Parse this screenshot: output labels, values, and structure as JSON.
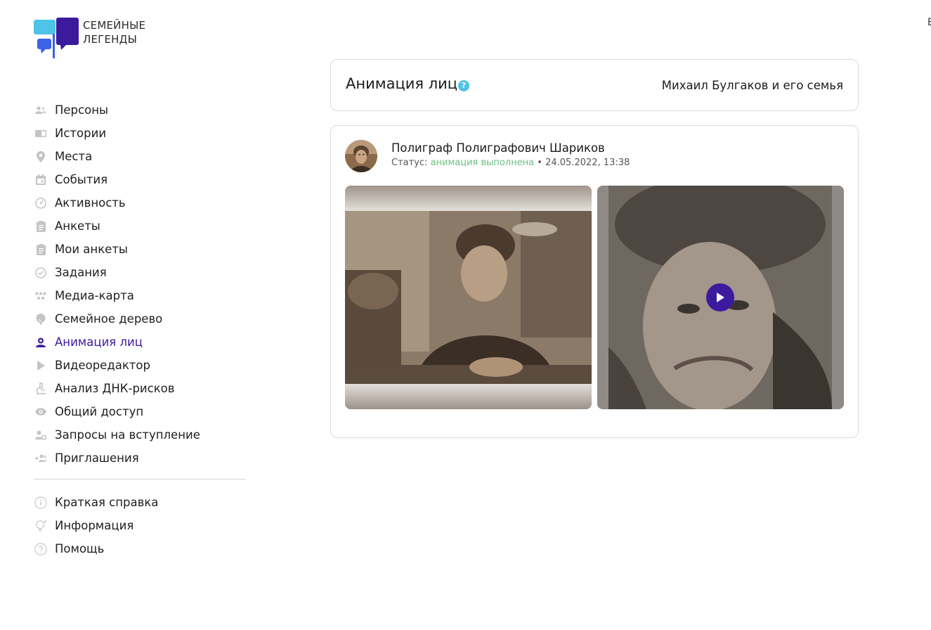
{
  "brand": {
    "line1": "СЕМЕЙНЫЕ",
    "line2": "ЛЕГЕНДЫ",
    "colors": {
      "light_blue": "#4fc3e8",
      "purple": "#3c1a9c",
      "blue": "#3c62e6"
    }
  },
  "corner_mark": "Е",
  "sidebar": {
    "items": [
      {
        "label": "Персоны",
        "icon": "persons-icon"
      },
      {
        "label": "Истории",
        "icon": "book-icon"
      },
      {
        "label": "Места",
        "icon": "location-pin-icon"
      },
      {
        "label": "События",
        "icon": "calendar-icon"
      },
      {
        "label": "Активность",
        "icon": "speedometer-icon"
      },
      {
        "label": "Анкеты",
        "icon": "clipboard-icon"
      },
      {
        "label": "Мои анкеты",
        "icon": "clipboard-icon"
      },
      {
        "label": "Задания",
        "icon": "check-circle-icon"
      },
      {
        "label": "Медиа-карта",
        "icon": "media-map-icon"
      },
      {
        "label": "Семейное дерево",
        "icon": "tree-icon"
      },
      {
        "label": "Анимация лиц",
        "icon": "face-icon",
        "active": true
      },
      {
        "label": "Видеоредактор",
        "icon": "play-icon"
      },
      {
        "label": "Анализ ДНК-рисков",
        "icon": "microscope-icon"
      },
      {
        "label": "Общий доступ",
        "icon": "eye-icon"
      },
      {
        "label": "Запросы на вступление",
        "icon": "user-gear-icon"
      },
      {
        "label": "Приглашения",
        "icon": "user-add-icon"
      }
    ],
    "footer_items": [
      {
        "label": "Краткая справка",
        "icon": "info-icon"
      },
      {
        "label": "Информация",
        "icon": "lightbulb-icon"
      },
      {
        "label": "Помощь",
        "icon": "question-icon"
      }
    ],
    "active_color": "#3c1a9c"
  },
  "header": {
    "title": "Анимация лиц",
    "help": "?",
    "family": "Михаил Булгаков и его семья"
  },
  "entry": {
    "name": "Полиграф Полиграфович Шариков",
    "status_label": "Статус:",
    "status_value": "анимация выполнена",
    "separator": "•",
    "datetime": "24.05.2022, 13:38",
    "status_color": "#6cbf84"
  }
}
